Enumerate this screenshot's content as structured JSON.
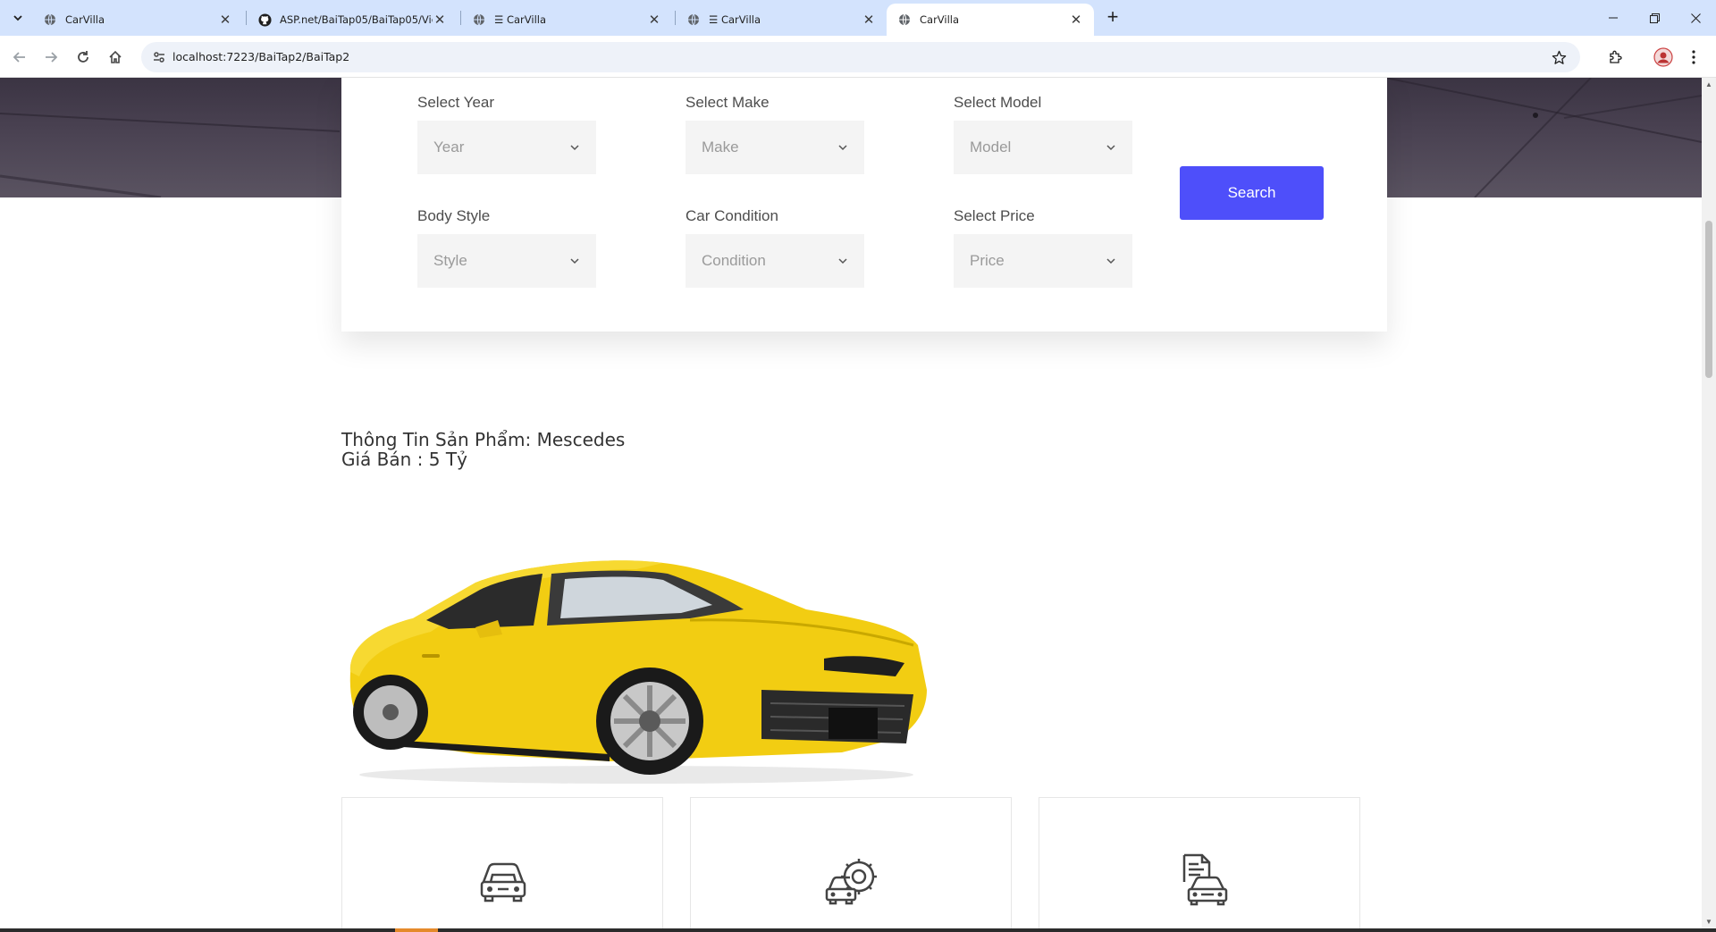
{
  "browser": {
    "tabs": [
      {
        "title": "CarVilla",
        "favicon": "globe-icon",
        "active": false
      },
      {
        "title": "ASP.net/BaiTap05/BaiTap05/Vie",
        "favicon": "github-icon",
        "active": false
      },
      {
        "title": "☰ CarVilla",
        "favicon": "globe-icon",
        "active": false
      },
      {
        "title": "☰ CarVilla",
        "favicon": "globe-icon",
        "active": false
      },
      {
        "title": "CarVilla",
        "favicon": "globe-icon",
        "active": true
      }
    ],
    "url": "localhost:7223/BaiTap2/BaiTap2"
  },
  "search_form": {
    "year": {
      "label": "Select Year",
      "placeholder": "Year"
    },
    "make": {
      "label": "Select Make",
      "placeholder": "Make"
    },
    "model": {
      "label": "Select Model",
      "placeholder": "Model"
    },
    "style": {
      "label": "Body Style",
      "placeholder": "Style"
    },
    "condition": {
      "label": "Car Condition",
      "placeholder": "Condition"
    },
    "price": {
      "label": "Select Price",
      "placeholder": "Price"
    },
    "search_label": "Search",
    "accent_color": "#4e4ffa"
  },
  "product": {
    "title": "Thông Tin Sản Phẩm: Mescedes",
    "price": "Giá Bán : 5 Tỷ",
    "image": "yellow-sports-car"
  },
  "services": [
    {
      "icon": "car-front-icon"
    },
    {
      "icon": "car-repair-gear-icon"
    },
    {
      "icon": "car-document-icon"
    }
  ]
}
